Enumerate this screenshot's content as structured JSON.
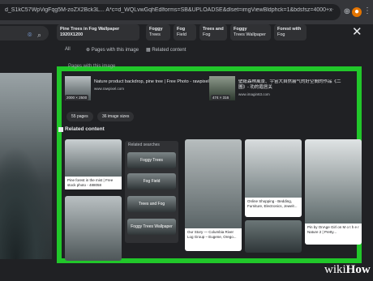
{
  "browser": {
    "url": "d_S1kC57WpVigFqg5M-zoZX2Bck3L... A*c=d_WQLvwGqhEdlforms=SB&UPLOADSE&dlset=imgViewBldphck=1&bdsfsz=4000+x+2666+=23..."
  },
  "chips": [
    {
      "line1": "Pine Trees in Fog Wallpaper 1920X1200",
      "line2": ""
    },
    {
      "line1": "Foggy",
      "line2": "Trees"
    },
    {
      "line1": "Fog",
      "line2": "Field"
    },
    {
      "line1": "Trees and",
      "line2": "Fog"
    },
    {
      "line1": "Foggy",
      "line2": "Trees Wallpaper"
    },
    {
      "line1": "Forest with",
      "line2": "Fog"
    }
  ],
  "tabs": [
    "All",
    "Pages with this image",
    "Related content"
  ],
  "pages_header": "Pages with this image",
  "results": [
    {
      "title": "Nature product backdrop, pine tree | Free Photo - rawpixel",
      "site": "www.rawpixel.com",
      "dims": "2000 × 2500"
    },
    {
      "title": "壁紙森林風景、宇宙大自然霧气的好空間的作品《二圖》- 劝的霞居关",
      "site": "www.imagin63.com",
      "dims": "474 × 316"
    }
  ],
  "pills": [
    "55 pages",
    "36 image sizes"
  ],
  "related_header": "Related content",
  "cards": [
    {
      "caption": "Pine forest in the mist | Free stock photo - 488058"
    },
    {
      "caption": "Our Story — Columbia River Log Group – Eugene, Orego..."
    },
    {
      "caption": "Online Shopping - Bedding, Furniture, Electronics, Jewelr..."
    },
    {
      "caption": "Pin by OnAge Girl on M o t h e r Nature 2 | Pretty..."
    }
  ],
  "related_searches": {
    "header": "Related searches",
    "items": [
      "Foggy Trees",
      "Fog Field",
      "Trees and Fog",
      "Foggy Trees Wallpaper"
    ]
  },
  "watermark": {
    "wiki": "wiki",
    "how": "How"
  }
}
